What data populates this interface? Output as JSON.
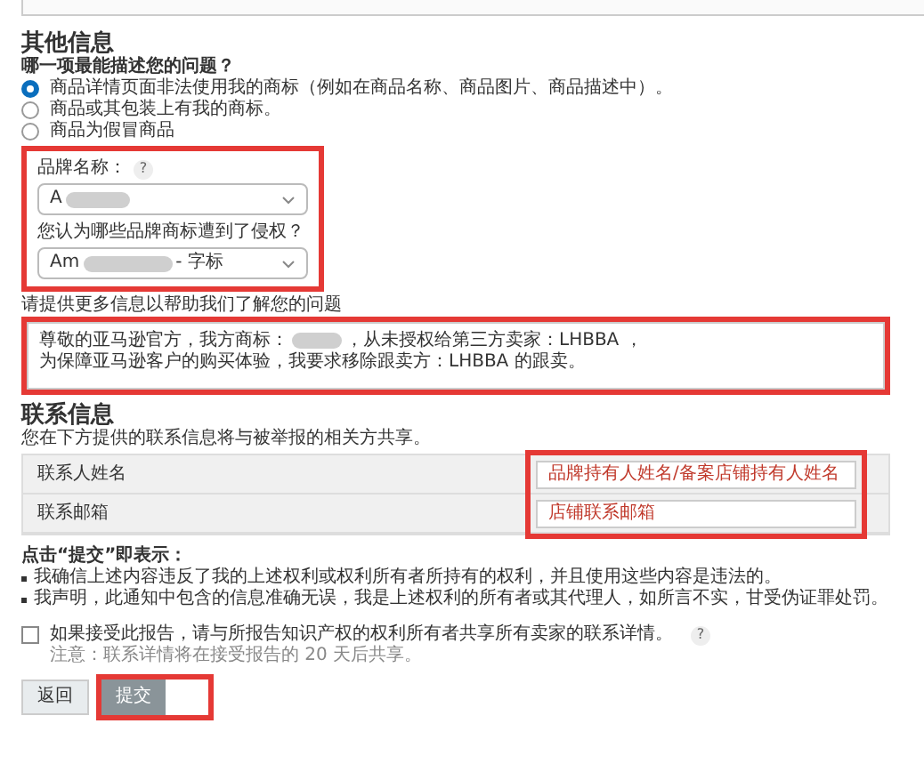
{
  "other_info": {
    "title": "其他信息",
    "question": "哪一项最能描述您的问题？",
    "options": [
      {
        "label": "商品详情页面非法使用我的商标（例如在商品名称、商品图片、商品描述中）。",
        "selected": true
      },
      {
        "label": "商品或其包装上有我的商标。",
        "selected": false
      },
      {
        "label": "商品为假冒商品",
        "selected": false
      }
    ],
    "brand_section": {
      "highlighted": true,
      "brand_label": "品牌名称：",
      "brand_help": "?",
      "brand_value": "A",
      "brand_redacted": true,
      "trademark_label": "您认为哪些品牌商标遭到了侵权？",
      "trademark_value": "Am",
      "trademark_redacted": true,
      "trademark_suffix": "- 字标"
    },
    "details": {
      "label": "请提供更多信息以帮助我们了解您的问题",
      "highlighted": true,
      "lines": [
        [
          {
            "kind": "text",
            "text": "尊敬的亚马逊官方，我方商标："
          },
          {
            "kind": "redacted"
          },
          {
            "kind": "text",
            "text": "，从未授权给第三方卖家：LHBBA ，"
          }
        ],
        [
          {
            "kind": "text",
            "text": "为保障亚马逊客户的购买体验，我要求移除跟卖方：LHBBA 的跟卖。"
          }
        ]
      ]
    }
  },
  "contact_info": {
    "title": "联系信息",
    "description": "您在下方提供的联系信息将与被举报的相关方共享。",
    "fields_highlighted": true,
    "rows": [
      {
        "label": "联系人姓名",
        "value": "品牌持有人姓名/备案店铺持有人姓名"
      },
      {
        "label": "联系邮箱",
        "value": "店铺联系邮箱"
      }
    ]
  },
  "declaration": {
    "intro": "点击“提交”即表示：",
    "bullets": [
      "我确信上述内容违反了我的上述权利或权利所有者所持有的权利，并且使用这些内容是违法的。",
      "我声明，此通知中包含的信息准确无误，我是上述权利的所有者或其代理人，如所言不实，甘受伪证罪处罚。"
    ]
  },
  "share_option": {
    "label": "如果接受此报告，请与所报告知识产权的权利所有者共享所有卖家的联系详情。",
    "help": "?",
    "checked": false,
    "note": "注意：联系详情将在接受报告的 20 天后共享。"
  },
  "buttons": [
    {
      "label": "返回",
      "kind": "secondary",
      "highlighted": false
    },
    {
      "label": "提交",
      "kind": "primary",
      "highlighted": true
    }
  ]
}
